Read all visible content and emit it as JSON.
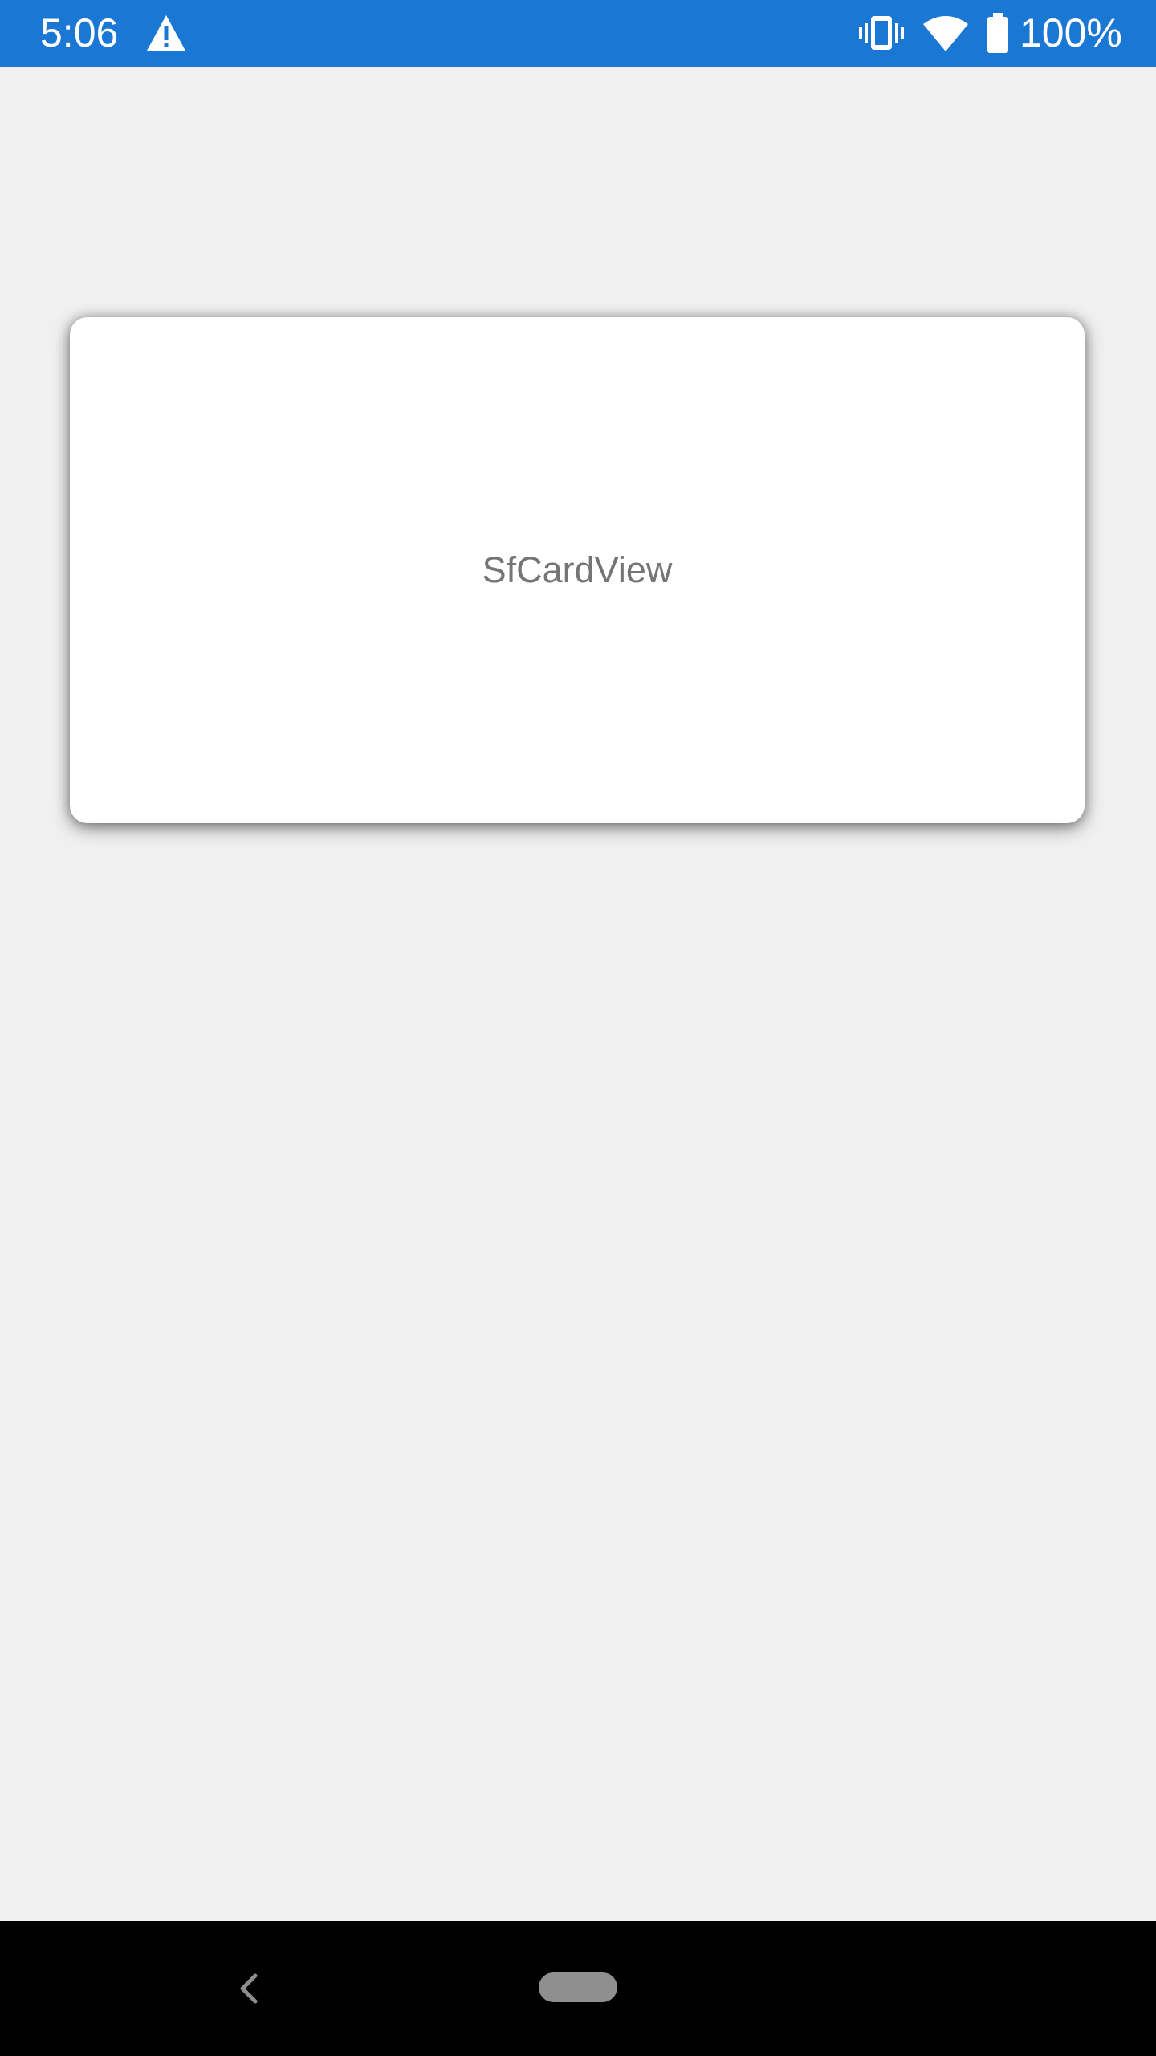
{
  "status_bar": {
    "time": "5:06",
    "battery_label": "100%",
    "background_color": "#1a77d4",
    "icons": [
      "warning-icon",
      "vibrate-icon",
      "wifi-icon",
      "battery-icon"
    ]
  },
  "card": {
    "label": "SfCardView",
    "background_color": "#ffffff"
  },
  "nav_bar": {
    "icons": [
      "back-icon",
      "home-pill"
    ],
    "background_color": "#000000"
  },
  "page": {
    "background_color": "#f0f0f0"
  }
}
